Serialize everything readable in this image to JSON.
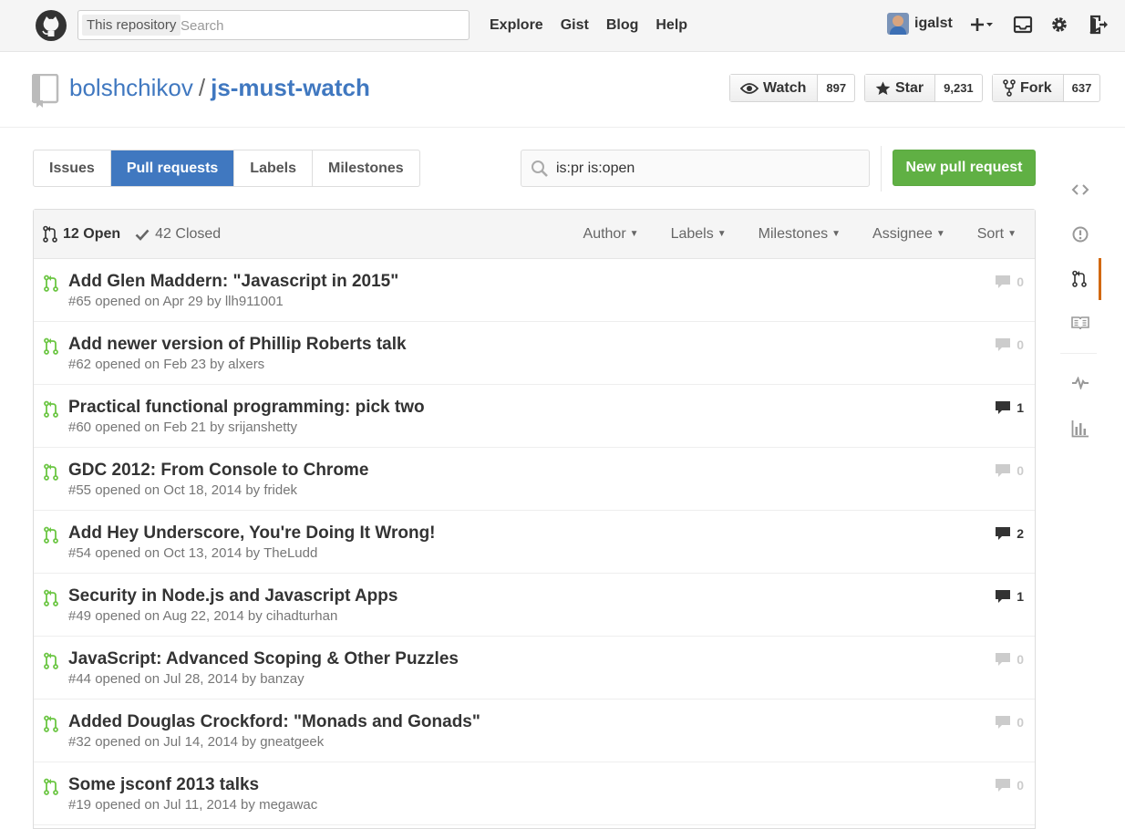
{
  "header": {
    "search_scope": "This repository",
    "search_placeholder": "Search",
    "nav": [
      "Explore",
      "Gist",
      "Blog",
      "Help"
    ],
    "username": "igalst"
  },
  "repo": {
    "owner": "bolshchikov",
    "separator": "/",
    "name": "js-must-watch",
    "watch_label": "Watch",
    "watch_count": "897",
    "star_label": "Star",
    "star_count": "9,231",
    "fork_label": "Fork",
    "fork_count": "637"
  },
  "subnav": {
    "tabs": [
      {
        "label": "Issues",
        "active": false
      },
      {
        "label": "Pull requests",
        "active": true
      },
      {
        "label": "Labels",
        "active": false
      },
      {
        "label": "Milestones",
        "active": false
      }
    ],
    "filter_value": "is:pr is:open",
    "new_button": "New pull request"
  },
  "table": {
    "open_label": "12 Open",
    "closed_label": "42 Closed",
    "filters": [
      "Author",
      "Labels",
      "Milestones",
      "Assignee",
      "Sort"
    ],
    "rows": [
      {
        "title": "Add Glen Maddern: \"Javascript in 2015\"",
        "number": "#65",
        "opened": "opened on Apr 29 by",
        "author": "llh911001",
        "comments": "0"
      },
      {
        "title": "Add newer version of Phillip Roberts talk",
        "number": "#62",
        "opened": "opened on Feb 23 by",
        "author": "alxers",
        "comments": "0"
      },
      {
        "title": "Practical functional programming: pick two",
        "number": "#60",
        "opened": "opened on Feb 21 by",
        "author": "srijanshetty",
        "comments": "1"
      },
      {
        "title": "GDC 2012: From Console to Chrome",
        "number": "#55",
        "opened": "opened on Oct 18, 2014 by",
        "author": "fridek",
        "comments": "0"
      },
      {
        "title": "Add Hey Underscore, You're Doing It Wrong!",
        "number": "#54",
        "opened": "opened on Oct 13, 2014 by",
        "author": "TheLudd",
        "comments": "2"
      },
      {
        "title": "Security in Node.js and Javascript Apps",
        "number": "#49",
        "opened": "opened on Aug 22, 2014 by",
        "author": "cihadturhan",
        "comments": "1"
      },
      {
        "title": "JavaScript: Advanced Scoping & Other Puzzles",
        "number": "#44",
        "opened": "opened on Jul 28, 2014 by",
        "author": "banzay",
        "comments": "0"
      },
      {
        "title": "Added Douglas Crockford: \"Monads and Gonads\"",
        "number": "#32",
        "opened": "opened on Jul 14, 2014 by",
        "author": "gneatgeek",
        "comments": "0"
      },
      {
        "title": "Some jsconf 2013 talks",
        "number": "#19",
        "opened": "opened on Jul 11, 2014 by",
        "author": "megawac",
        "comments": "0"
      }
    ]
  },
  "colors": {
    "accent": "#4078c0",
    "open_green": "#6cc644",
    "button_green": "#60b044",
    "active_side": "#d26911"
  },
  "icons": {
    "logo": "github-octocat-icon",
    "side_nav": [
      "code-icon",
      "issue-icon",
      "pull-request-icon",
      "wiki-icon",
      "pulse-icon",
      "graph-icon"
    ]
  }
}
